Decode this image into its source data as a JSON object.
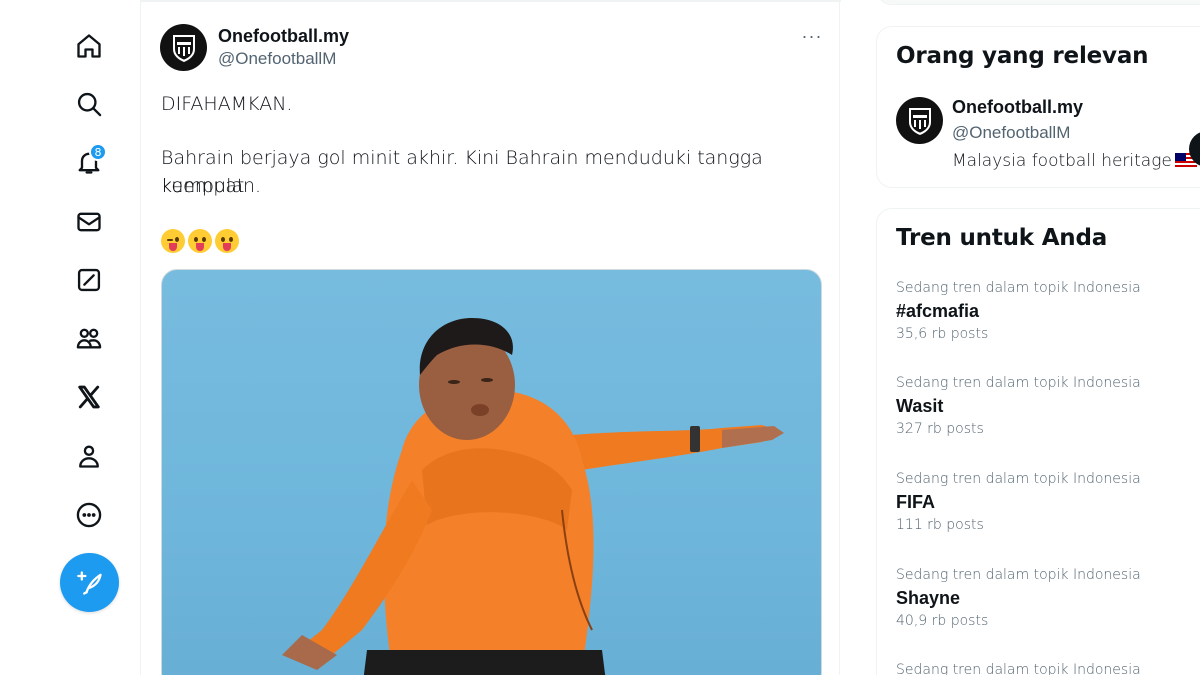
{
  "nav": {
    "items": [
      {
        "name": "home",
        "icon": "home-icon"
      },
      {
        "name": "explore",
        "icon": "search-icon"
      },
      {
        "name": "notifications",
        "icon": "bell-icon",
        "badge": "8"
      },
      {
        "name": "messages",
        "icon": "mail-icon"
      },
      {
        "name": "grok",
        "icon": "grok-icon"
      },
      {
        "name": "communities",
        "icon": "people-icon"
      },
      {
        "name": "premium",
        "icon": "x-logo-icon"
      },
      {
        "name": "profile",
        "icon": "person-icon"
      },
      {
        "name": "more",
        "icon": "more-circle-icon"
      }
    ],
    "post_button_icon": "feather-plus-icon",
    "accent": "#1d9bf0"
  },
  "tweet": {
    "author_name": "Onefootball.my",
    "author_handle": "@OnefootballM",
    "more": "···",
    "paragraph1": "DIFAHAMKAN.",
    "paragraph2_line1": "Bahrain berjaya gol minit akhir. Kini Bahrain menduduki tangga keempat",
    "paragraph2_line2": "kumpulan.",
    "emojis": [
      "winking-face-with-tongue",
      "face-with-tongue",
      "face-with-tongue"
    ],
    "media_description_color": "#6fb6dc"
  },
  "sidebar": {
    "relevant": {
      "title": "Orang yang relevan",
      "people": [
        {
          "name": "Onefootball.my",
          "handle": "@OnefootballM",
          "bio_prefix": "Malaysia football heritage",
          "bio_suffix": "!"
        }
      ]
    },
    "trends": {
      "title": "Tren untuk Anda",
      "items": [
        {
          "meta": "Sedang tren dalam topik Indonesia",
          "name": "#afcmafia",
          "count": "35,6 rb posts"
        },
        {
          "meta": "Sedang tren dalam topik Indonesia",
          "name": "Wasit",
          "count": "327 rb posts"
        },
        {
          "meta": "Sedang tren dalam topik Indonesia",
          "name": "FIFA",
          "count": "111 rb posts"
        },
        {
          "meta": "Sedang tren dalam topik Indonesia",
          "name": "Shayne",
          "count": "40,9 rb posts"
        },
        {
          "meta": "Sedang tren dalam topik Indonesia",
          "name": "",
          "count": ""
        }
      ]
    }
  }
}
